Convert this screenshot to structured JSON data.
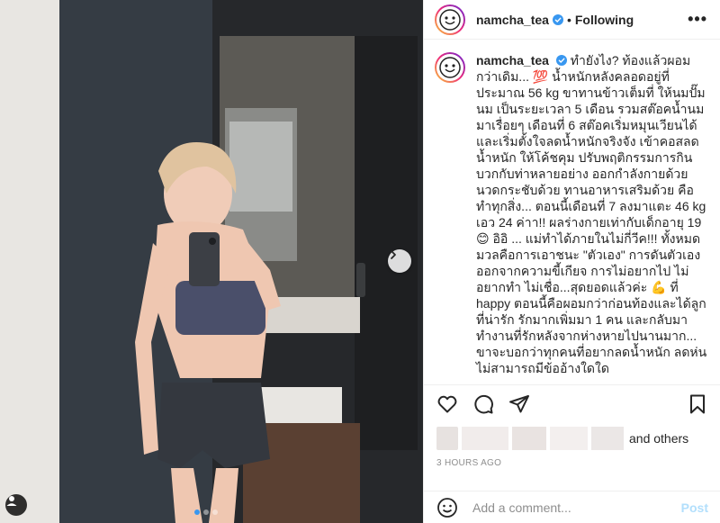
{
  "header": {
    "username": "namcha_tea",
    "separator": "•",
    "follow_status": "Following",
    "more_label": "•••"
  },
  "caption": {
    "username": "namcha_tea",
    "text": "ทำยังไง? ท้องแล้วผอมกว่าเดิม... 💯 น้ำหนักหลังคลอดอยู่ที่ประมาณ 56 kg ขาทานข้าวเต็มที่ ให้นมปั๊มนม เป็นระยะเวลา 5 เดือน รวมสต๊อคน้ำนมมาเรื่อยๆ เดือนที่ 6 สต๊อคเริ่มหมุนเวียนได้ และเริ่มตั้งใจลดน้ำหนักจริงจัง เข้าคอสลดน้ำหนัก ให้โค้ชคุม ปรับพฤติกรรมการกิน บวกกับท่าหลายอย่าง ออกกำลังกายด้วย นวดกระชับด้วย ทานอาหารเสริมด้วย คือทำทุกสิ่ง... ตอนนี้เดือนที่ 7 ลงมาแตะ 46 kg เอว 24 ค่าา!! ผลร่างกายเท่ากับเด็กอายุ 19 😊 อิอิ ... แม่ทำได้ภายในไม่กี่วีค!!! ทั้งหมดมวลคือการเอาชนะ \"ตัวเอง\" การดันตัวเองออกจากความขี้เกียจ การไม่อยากไป ไม่อยากทำ ไม่เชื่อ...สุดยอดแล้วค่ะ 💪 ที่ happy ตอนนี้คือผอมกว่าก่อนท้องและได้ลูกที่น่ารัก รักมากเพิ่มมา 1 คน และกลับมาทำงานที่รักหลังจากห่างหายไปนานมาก... ขาจะบอกว่าทุกคนที่อยากลดน้ำหนัก ลดห่นไม่สามารถมีข้ออ้างใดใด"
  },
  "likes": {
    "suffix": "and others"
  },
  "timestamp": "3 HOURS AGO",
  "comment_box": {
    "placeholder": "Add a comment...",
    "post_label": "Post"
  },
  "icons": {
    "like": "heart-icon",
    "comment": "comment-icon",
    "share": "paper-plane-icon",
    "save": "bookmark-icon",
    "emoji": "smiley-icon",
    "next": "chevron-right-icon",
    "tag": "user-tag-icon",
    "verified": "verified-badge-icon"
  },
  "carousel": {
    "total": 3,
    "active_index": 0
  },
  "colors": {
    "link_blue": "#3897f0",
    "post_disabled": "#b2dffc",
    "verified": "#3897f0",
    "muted": "#8e8e8e",
    "border": "#efefef"
  }
}
